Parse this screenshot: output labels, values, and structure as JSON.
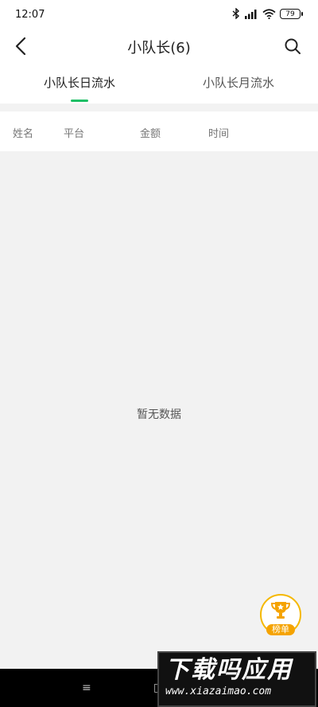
{
  "status": {
    "time": "12:07",
    "battery": "79"
  },
  "header": {
    "title": "小队长(6)"
  },
  "tabs": [
    {
      "label": "小队长日流水"
    },
    {
      "label": "小队长月流水"
    }
  ],
  "table": {
    "columns": [
      "姓名",
      "平台",
      "金额",
      "时间"
    ]
  },
  "empty_text": "暂无数据",
  "rank_badge": {
    "label": "榜单"
  },
  "watermark": {
    "main": "下载吗应用",
    "sub": "www.xiazaimao.com"
  },
  "colors": {
    "accent": "#1fbf66",
    "badge": "#f5a300"
  }
}
